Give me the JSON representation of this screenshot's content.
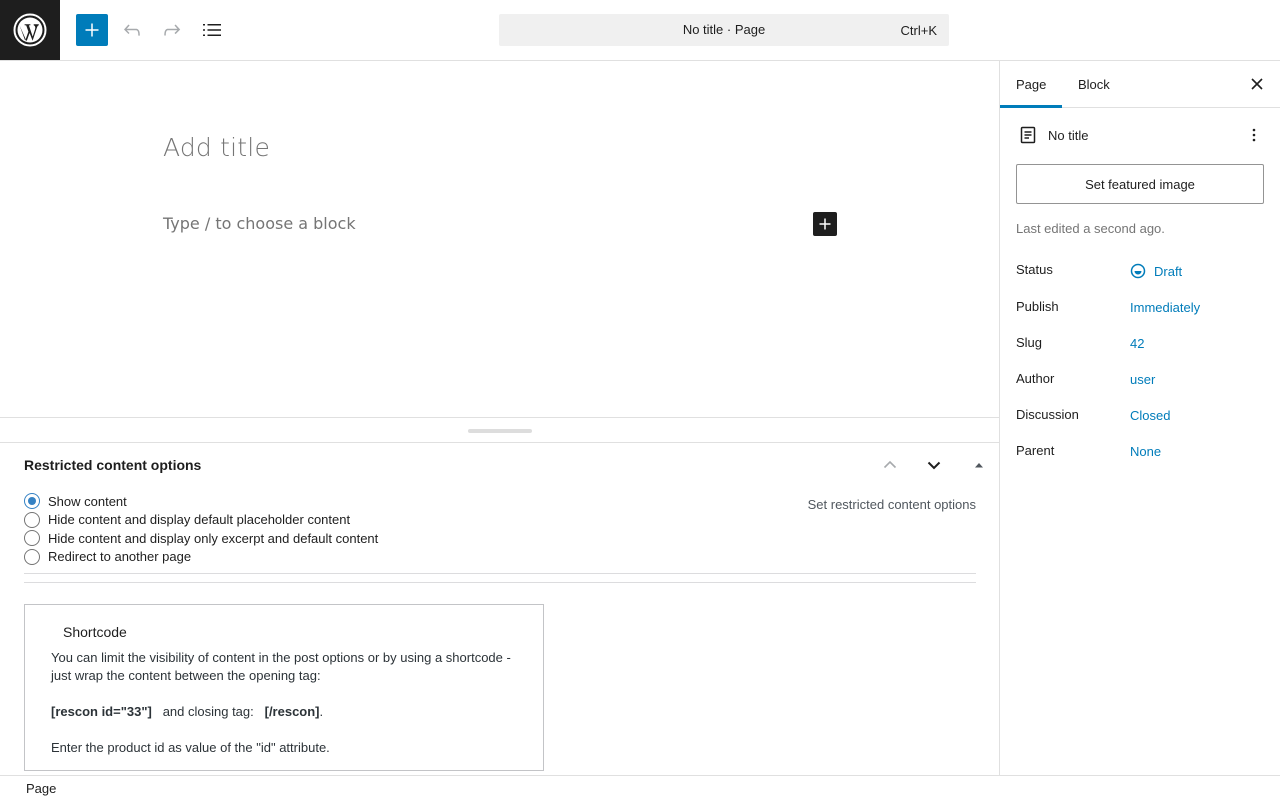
{
  "header": {
    "command_title": "No title · Page",
    "command_shortcut": "Ctrl+K"
  },
  "editor": {
    "title_placeholder": "Add title",
    "block_placeholder": "Type / to choose a block"
  },
  "metabox": {
    "title": "Restricted content options",
    "side_label": "Set restricted content options",
    "options": [
      {
        "label": "Show content",
        "checked": true
      },
      {
        "label": "Hide content and display default placeholder content",
        "checked": false
      },
      {
        "label": "Hide content and display only excerpt and default content",
        "checked": false
      },
      {
        "label": "Redirect to another page",
        "checked": false
      }
    ],
    "shortcode": {
      "heading": "Shortcode",
      "line1": "You can limit the visibility of content in the post options or by using a shortcode -",
      "line2": "just wrap the content between the opening tag:",
      "open_tag": "[rescon id=\"33\"]",
      "middle": "and closing tag:",
      "close_tag": "[/rescon]",
      "period": ".",
      "note": "Enter the product id as value of the \"id\" attribute."
    }
  },
  "footer": {
    "breadcrumb": "Page"
  },
  "sidebar": {
    "tabs": [
      {
        "label": "Page",
        "active": true
      },
      {
        "label": "Block",
        "active": false
      }
    ],
    "doc_title": "No title",
    "featured_button": "Set featured image",
    "last_edited": "Last edited a second ago.",
    "properties": [
      {
        "label": "Status",
        "value": "Draft"
      },
      {
        "label": "Publish",
        "value": "Immediately"
      },
      {
        "label": "Slug",
        "value": "42"
      },
      {
        "label": "Author",
        "value": "user"
      },
      {
        "label": "Discussion",
        "value": "Closed"
      },
      {
        "label": "Parent",
        "value": "None"
      }
    ]
  },
  "colors": {
    "accent": "#007cba",
    "dark": "#1e1e1e",
    "muted": "#757575"
  },
  "icons": {
    "logo": "wordpress-logo-icon",
    "add": "plus-icon",
    "undo": "undo-icon",
    "redo": "redo-icon",
    "list_view": "list-view-icon",
    "close": "close-icon",
    "page": "page-icon",
    "more": "more-vertical-icon",
    "draft": "draft-status-icon"
  }
}
